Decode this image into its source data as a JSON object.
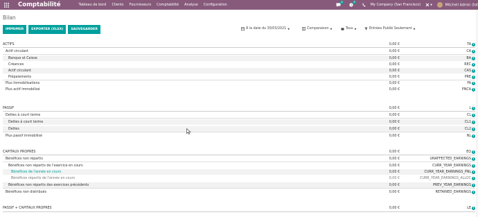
{
  "topbar": {
    "app_name": "Comptabilité",
    "menu": [
      "Tableau de bord",
      "Clients",
      "Fournisseurs",
      "Comptabilité",
      "Analyse",
      "Configuration"
    ],
    "chat_count": "6",
    "activity_count": "8",
    "company": "My Company (San Francisco)",
    "user": "Mitchell Admin (tot"
  },
  "page": {
    "breadcrumb": "Bilan",
    "buttons": {
      "print": "IMPRIMER",
      "export": "EXPORTER (XLSX)",
      "save": "SAUVEGARDER"
    },
    "filters": {
      "date": "À la date du 30/03/2021",
      "comparison": "Comparaison",
      "journals": "Tous",
      "entries": "Entrées Publié Seulement"
    }
  },
  "report": {
    "rows": [
      {
        "label": "ACTIFS",
        "value": "0,00 €",
        "code": "TA"
      },
      {
        "label": "Actif circulant",
        "value": "0,00 €",
        "code": "CA"
      },
      {
        "label": "Banque et Caisse",
        "value": "0,00 €",
        "code": "BA"
      },
      {
        "label": "Créances",
        "value": "0,00 €",
        "code": "REC"
      },
      {
        "label": "Actif circulant",
        "value": "0,00 €",
        "code": "CAS"
      },
      {
        "label": "Prépaiements",
        "value": "0,00 €",
        "code": "PRE"
      },
      {
        "label": "Plus Immobilisations",
        "value": "0,00 €",
        "code": "FA"
      },
      {
        "label": "Plus actif immobilisé",
        "value": "0,00 €",
        "code": "PNCA"
      },
      {
        "label": "PASSIF",
        "value": "0,00 €",
        "code": "L"
      },
      {
        "label": "Dettes à court terme",
        "value": "0,00 €",
        "code": "CL"
      },
      {
        "label": "Dettes à court terme",
        "value": "0,00 €",
        "code": "CL1"
      },
      {
        "label": "Dettes",
        "value": "0,00 €",
        "code": "CL2"
      },
      {
        "label": "Plus passif immobilisé",
        "value": "0,00 €",
        "code": "NL"
      },
      {
        "label": "CAPITAUX PROPRES",
        "value": "0,00 €",
        "code": "EQ"
      },
      {
        "label": "Bénéfices non répartis",
        "value": "0,00 €",
        "code": "UNAFFECTED_EARNINGS"
      },
      {
        "label": "Bénéfices non répartis de l'exercice en cours",
        "value": "0,00 €",
        "code": "CURR_YEAR_EARNINGS"
      },
      {
        "label": "Bénéfices de l'année en cours",
        "value": "0,00 €",
        "code": "CURR_YEAR_EARNINGS_PNL"
      },
      {
        "label": "Bénéfices répartis de l'année en cours",
        "value": "0,00 €",
        "code": "CURR_YEAR_EARNINGS_ALLOC"
      },
      {
        "label": "Bénéfices non répartis des exercices précédents",
        "value": "0,00 €",
        "code": "PREV_YEAR_EARNINGS"
      },
      {
        "label": "Bénéfices non distribués",
        "value": "0,00 €",
        "code": "RETAINED_EARNINGS"
      },
      {
        "label": "PASSIF + CAPITAUX PROPRES",
        "value": "0,00 €",
        "code": "LE"
      }
    ]
  },
  "colors": {
    "brand": "#875a7b",
    "accent": "#00a09d"
  }
}
